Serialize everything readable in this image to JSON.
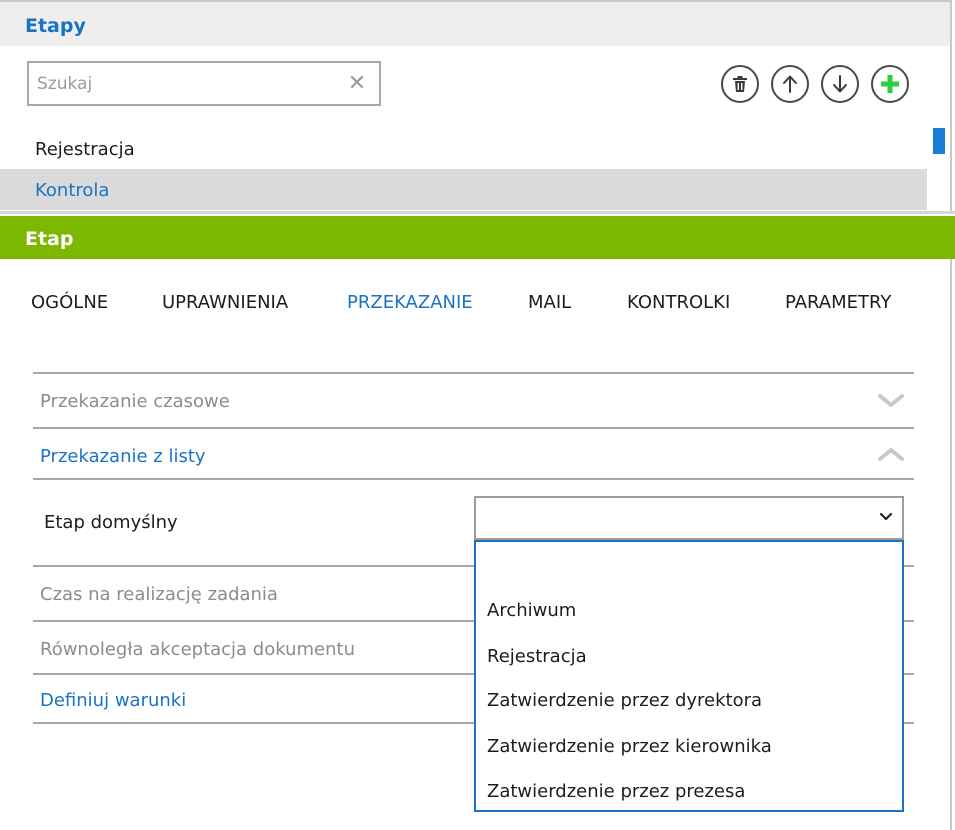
{
  "stages_panel": {
    "title": "Etapy",
    "search": {
      "placeholder": "Szukaj",
      "value": "",
      "clear_glyph": "✕"
    },
    "toolbar": [
      "trash-icon",
      "arrow-up-icon",
      "arrow-down-icon",
      "plus-icon"
    ],
    "items": [
      {
        "label": "Rejestracja",
        "selected": false
      },
      {
        "label": "Kontrola",
        "selected": true
      }
    ]
  },
  "stage_panel": {
    "title": "Etap",
    "tabs": [
      {
        "label": "OGÓLNE",
        "active": false
      },
      {
        "label": "UPRAWNIENIA",
        "active": false
      },
      {
        "label": "PRZEKAZANIE",
        "active": true
      },
      {
        "label": "MAIL",
        "active": false
      },
      {
        "label": "KONTROLKI",
        "active": false
      },
      {
        "label": "PARAMETRY",
        "active": false
      }
    ],
    "sections": {
      "timed": {
        "label": "Przekazanie czasowe",
        "expanded": false
      },
      "from_list": {
        "label": "Przekazanie z listy",
        "expanded": true
      },
      "task_time": {
        "label": "Czas na realizację zadania"
      },
      "parallel": {
        "label": "Równoległa akceptacja dokumentu"
      },
      "conditions": {
        "label": "Definiuj warunki"
      }
    },
    "default_stage": {
      "label": "Etap domyślny",
      "value": "",
      "options": [
        "",
        "Archiwum",
        "Rejestracja",
        "Zatwierdzenie przez dyrektora",
        "Zatwierdzenie przez kierownika",
        "Zatwierdzenie przez prezesa"
      ]
    }
  },
  "colors": {
    "accent_blue": "#1a73c2",
    "header_green": "#7db800",
    "add_green": "#2ecc40",
    "muted_text": "#8c8c8c"
  }
}
